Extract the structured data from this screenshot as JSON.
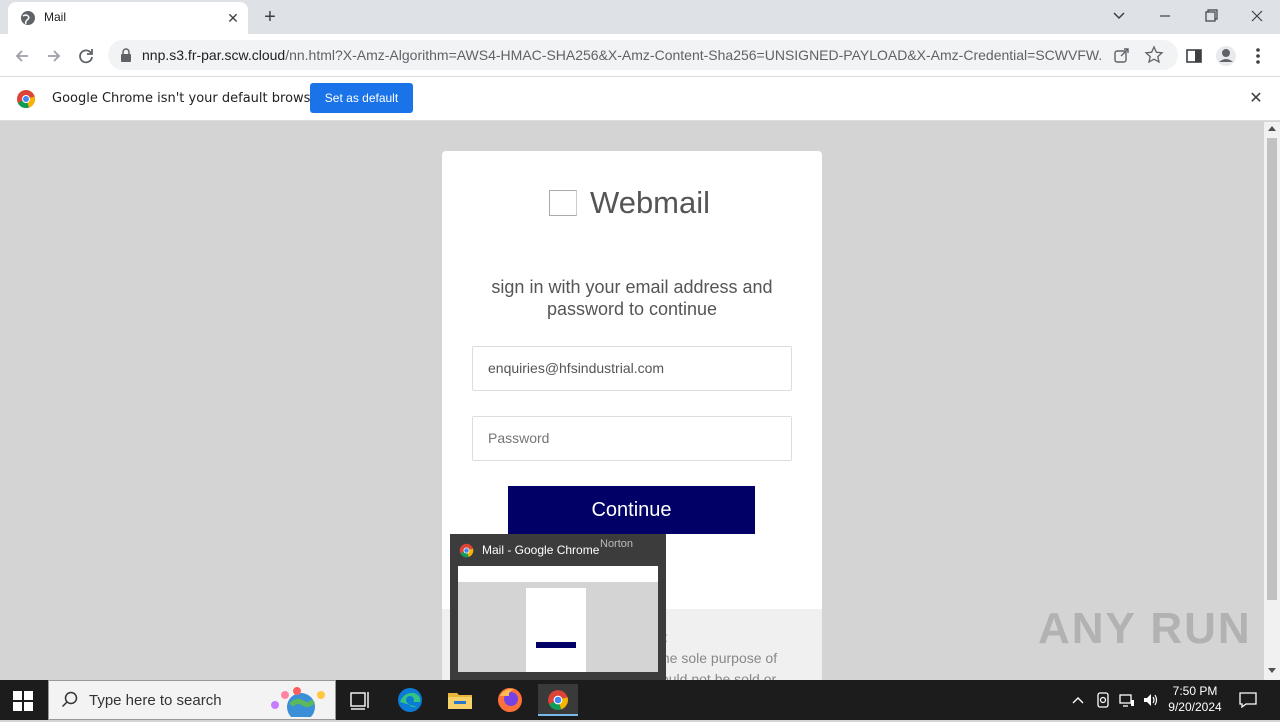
{
  "browser": {
    "tab_title": "Mail",
    "url_host": "nnp.s3.fr-par.scw.cloud",
    "url_rest": "/nn.html?X-Amz-Algorithm=AWS4-HMAC-SHA256&X-Amz-Content-Sha256=UNSIGNED-PAYLOAD&X-Amz-Credential=SCWVFW...",
    "infobar_message": "Google Chrome isn't your default browser",
    "set_default_label": "Set as default"
  },
  "page": {
    "brand": "Webmail",
    "heading": "sign in with your email address and password to continue",
    "email_value": "enquiries@hfsindustrial.com",
    "password_placeholder": "Password",
    "continue_label": "Continue",
    "footer_fragment_1": "cy:",
    "footer_fragment_2": "the sole purpose of",
    "footer_fragment_3": "viewing this document and would not be sold or"
  },
  "preview": {
    "title": "Mail - Google Chrome",
    "badge": "Norton"
  },
  "watermark": "ANY RUN",
  "taskbar": {
    "search_placeholder": "Type here to search",
    "time": "7:50 PM",
    "date": "9/20/2024"
  },
  "colors": {
    "accent": "#1a73e8",
    "continue_bg": "#000066"
  }
}
